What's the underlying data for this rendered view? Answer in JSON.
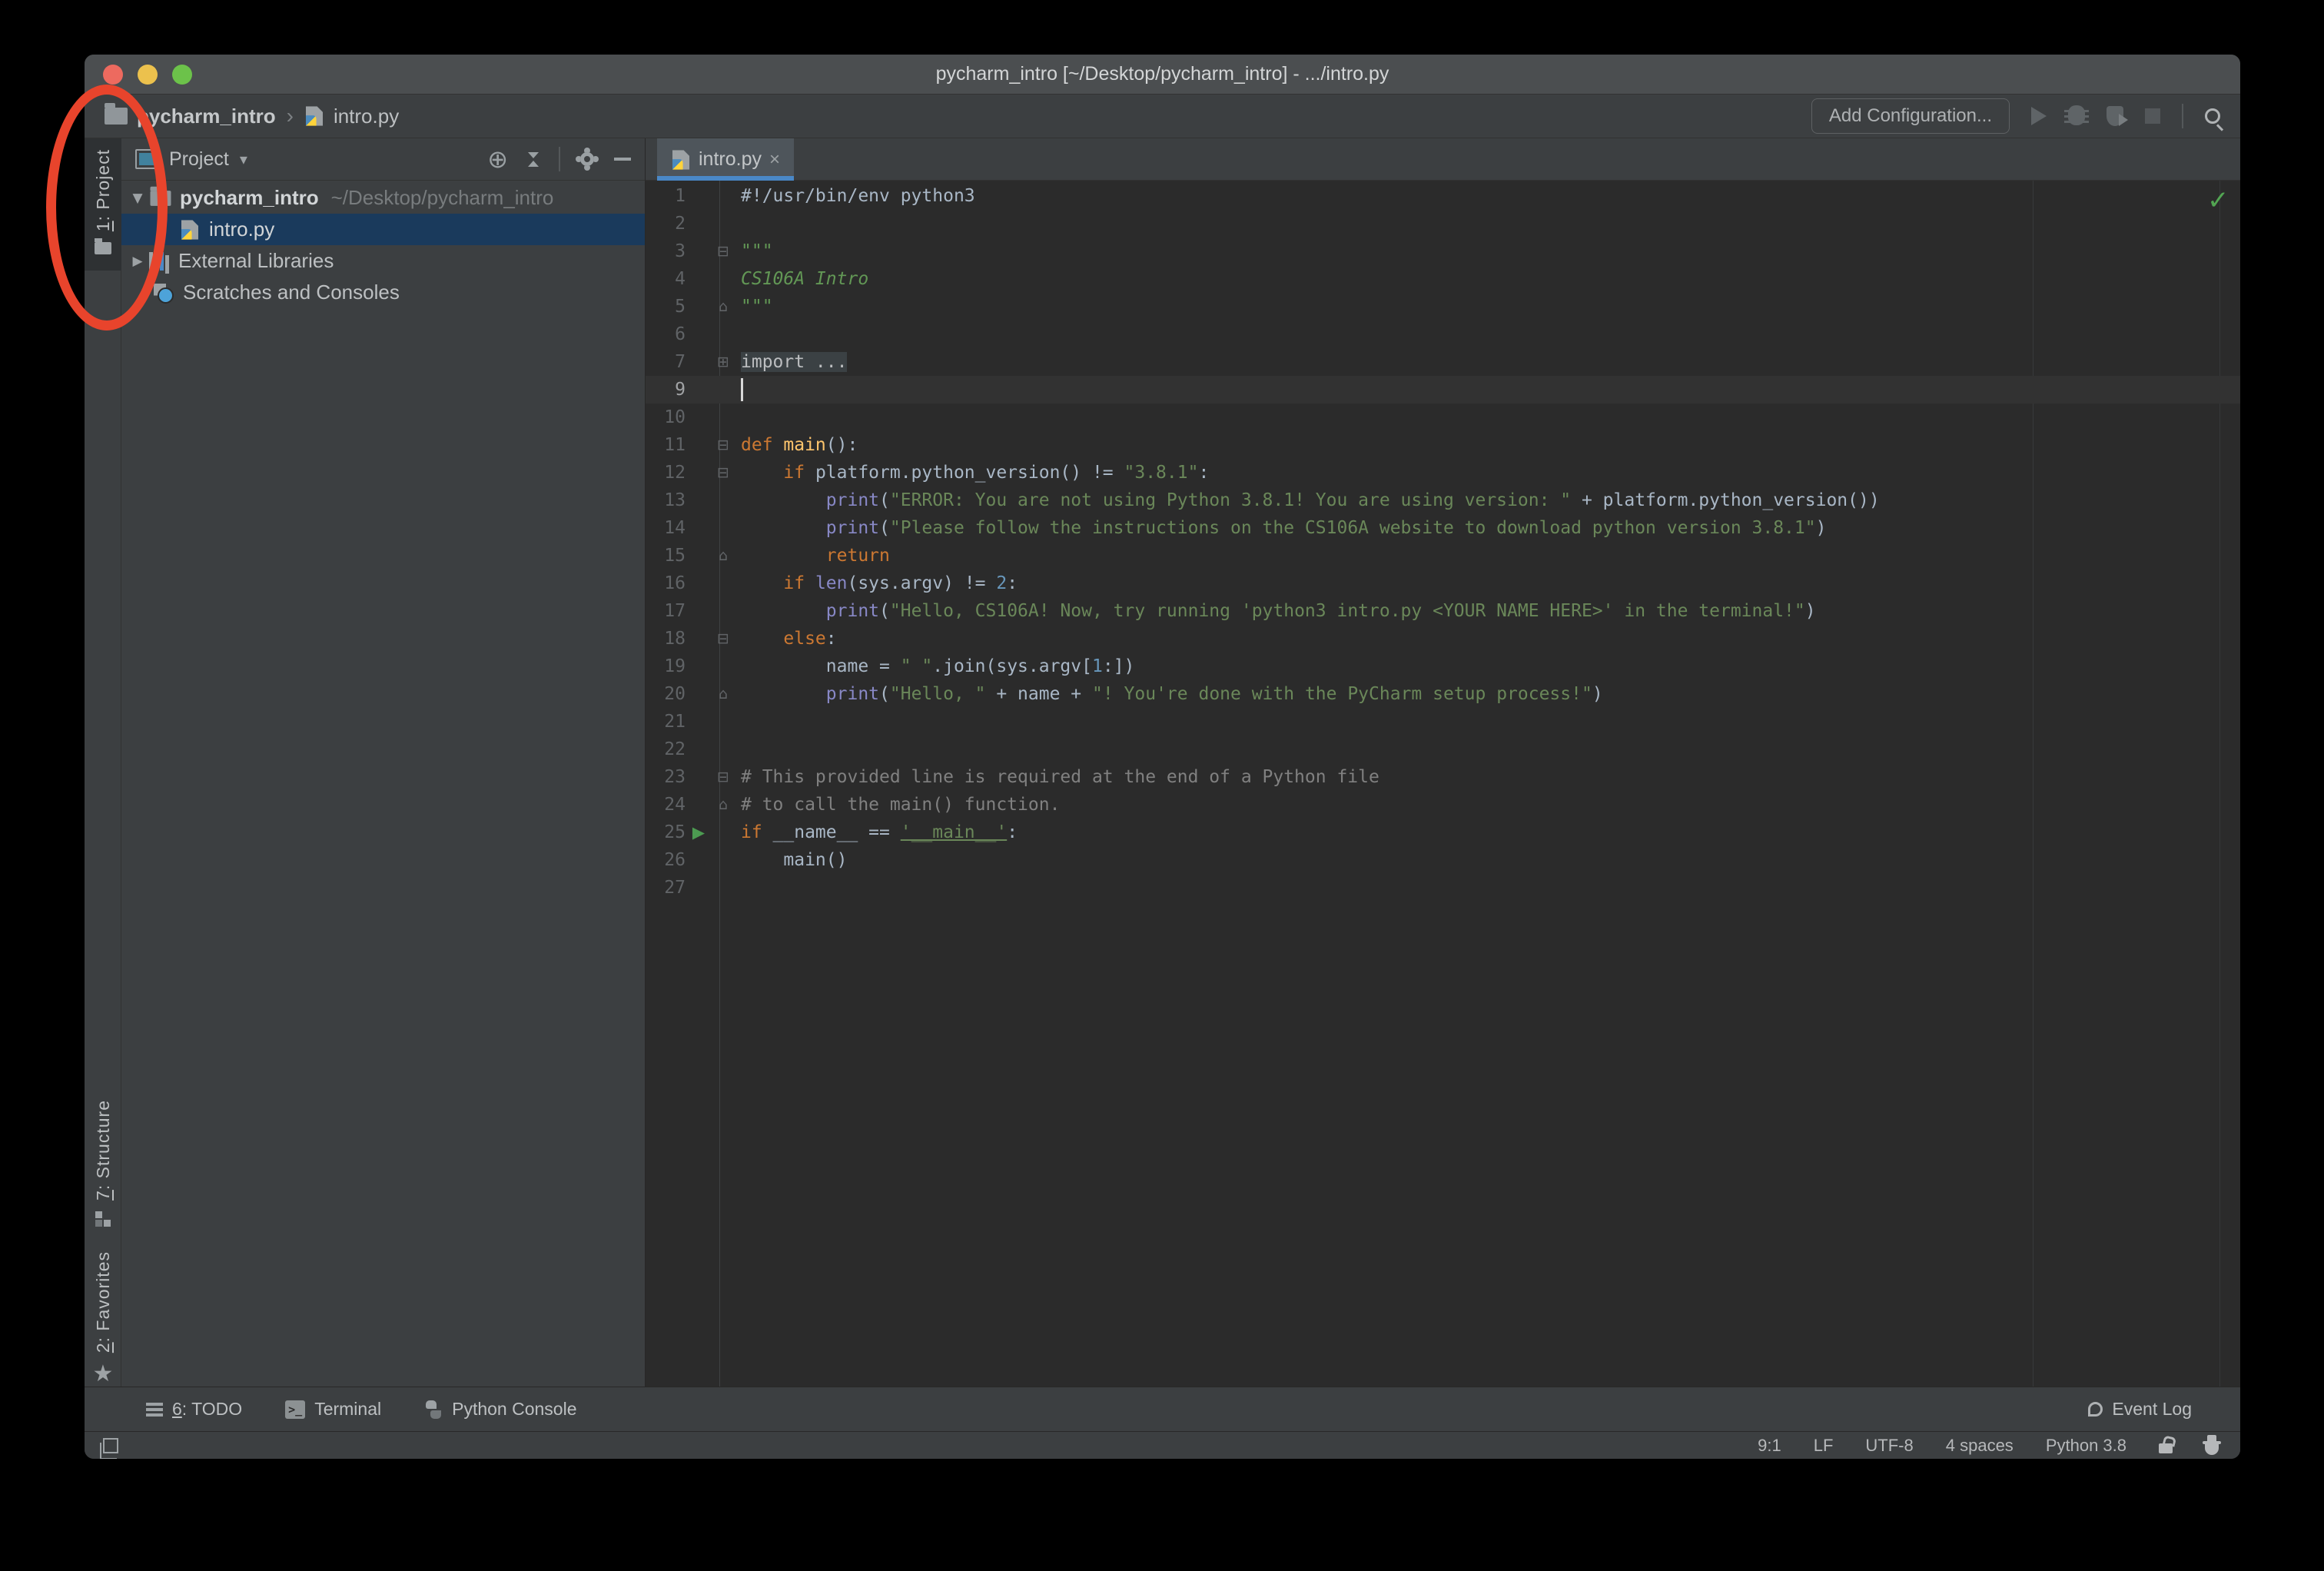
{
  "window_title": "pycharm_intro [~/Desktop/pycharm_intro] - .../intro.py",
  "navbar": {
    "breadcrumb_project": "pycharm_intro",
    "breadcrumb_separator": "›",
    "breadcrumb_file": "intro.py",
    "add_configuration": "Add Configuration..."
  },
  "left_strip": {
    "project": {
      "num": "1",
      "rest": ": Project"
    },
    "structure": {
      "num": "7",
      "rest": ": Structure"
    },
    "favorites": {
      "num": "2",
      "rest": ": Favorites"
    }
  },
  "project_panel": {
    "header": {
      "title": "Project",
      "caret": "▾"
    },
    "tree": {
      "arrow_open": "▼",
      "arrow_closed": "▶",
      "root_name": "pycharm_intro",
      "root_path": "~/Desktop/pycharm_intro",
      "file": "intro.py",
      "external": "External Libraries",
      "scratches": "Scratches and Consoles"
    }
  },
  "editor": {
    "tab": {
      "label": "intro.py",
      "close": "×"
    },
    "inspection_check": "✓",
    "lines": [
      {
        "n": 1,
        "seg": [
          [
            "txt",
            "#!/usr/bin/env python3"
          ]
        ]
      },
      {
        "n": 2,
        "seg": []
      },
      {
        "n": 3,
        "fold": "top",
        "seg": [
          [
            "doc",
            "\"\"\""
          ]
        ]
      },
      {
        "n": 4,
        "seg": [
          [
            "doc",
            "CS106A Intro"
          ]
        ]
      },
      {
        "n": 5,
        "fold": "bottom",
        "seg": [
          [
            "doc",
            "\"\"\""
          ]
        ]
      },
      {
        "n": 6,
        "seg": []
      },
      {
        "n": 7,
        "fold": "closed",
        "seg": [
          [
            "folded",
            "import ..."
          ]
        ]
      },
      {
        "n": 9,
        "caret": true,
        "seg": []
      },
      {
        "n": 10,
        "seg": []
      },
      {
        "n": 11,
        "fold": "top",
        "seg": [
          [
            "kw",
            "def "
          ],
          [
            "fn",
            "main"
          ],
          [
            "txt",
            "():"
          ]
        ]
      },
      {
        "n": 12,
        "fold": "top",
        "seg": [
          [
            "txt",
            "    "
          ],
          [
            "kw",
            "if "
          ],
          [
            "txt",
            "platform.python_version() != "
          ],
          [
            "str",
            "\"3.8.1\""
          ],
          [
            "txt",
            ":"
          ]
        ]
      },
      {
        "n": 13,
        "seg": [
          [
            "txt",
            "        "
          ],
          [
            "bi",
            "print"
          ],
          [
            "txt",
            "("
          ],
          [
            "str",
            "\"ERROR: You are not using Python 3.8.1! You are using version: \""
          ],
          [
            "txt",
            " + platform.python_version())"
          ]
        ]
      },
      {
        "n": 14,
        "seg": [
          [
            "txt",
            "        "
          ],
          [
            "bi",
            "print"
          ],
          [
            "txt",
            "("
          ],
          [
            "str",
            "\"Please follow the instructions on the CS106A website to download python version 3.8.1\""
          ],
          [
            "txt",
            ")"
          ]
        ]
      },
      {
        "n": 15,
        "fold": "bottom",
        "seg": [
          [
            "txt",
            "        "
          ],
          [
            "kw",
            "return"
          ]
        ]
      },
      {
        "n": 16,
        "seg": [
          [
            "txt",
            "    "
          ],
          [
            "kw",
            "if "
          ],
          [
            "bi",
            "len"
          ],
          [
            "txt",
            "(sys.argv) != "
          ],
          [
            "num",
            "2"
          ],
          [
            "txt",
            ":"
          ]
        ]
      },
      {
        "n": 17,
        "seg": [
          [
            "txt",
            "        "
          ],
          [
            "bi",
            "print"
          ],
          [
            "txt",
            "("
          ],
          [
            "str",
            "\"Hello, CS106A! Now, try running 'python3 intro.py <YOUR NAME HERE>' in the terminal!\""
          ],
          [
            "txt",
            ")"
          ]
        ]
      },
      {
        "n": 18,
        "fold": "top",
        "seg": [
          [
            "txt",
            "    "
          ],
          [
            "kw",
            "else"
          ],
          [
            "txt",
            ":"
          ]
        ]
      },
      {
        "n": 19,
        "seg": [
          [
            "txt",
            "        name = "
          ],
          [
            "str",
            "\" \""
          ],
          [
            "txt",
            ".join(sys.argv["
          ],
          [
            "num",
            "1"
          ],
          [
            "txt",
            ":])"
          ]
        ]
      },
      {
        "n": 20,
        "fold": "bottom",
        "seg": [
          [
            "txt",
            "        "
          ],
          [
            "bi",
            "print"
          ],
          [
            "txt",
            "("
          ],
          [
            "str",
            "\"Hello, \""
          ],
          [
            "txt",
            " + name + "
          ],
          [
            "str",
            "\"! You're done with the PyCharm setup process!\""
          ],
          [
            "txt",
            ")"
          ]
        ]
      },
      {
        "n": 21,
        "seg": []
      },
      {
        "n": 22,
        "seg": []
      },
      {
        "n": 23,
        "fold": "top",
        "seg": [
          [
            "cmt",
            "# This provided line is required at the end of a Python file"
          ]
        ]
      },
      {
        "n": 24,
        "fold": "bottom",
        "seg": [
          [
            "cmt",
            "# to call the main() function."
          ]
        ]
      },
      {
        "n": 25,
        "run": true,
        "seg": [
          [
            "kw",
            "if "
          ],
          [
            "txt",
            "__name__ == "
          ],
          [
            "strU",
            "'__main__'"
          ],
          [
            "txt",
            ":"
          ]
        ]
      },
      {
        "n": 26,
        "seg": [
          [
            "txt",
            "    main()"
          ]
        ]
      },
      {
        "n": 27,
        "seg": []
      }
    ]
  },
  "toolbar": {
    "todo": {
      "num": "6",
      "rest": ": TODO"
    },
    "terminal": "Terminal",
    "python_console": "Python Console",
    "event_log": "Event Log",
    "terminal_glyph": ">_"
  },
  "statusbar": {
    "position": "9:1",
    "line_ending": "LF",
    "encoding": "UTF-8",
    "indent": "4 spaces",
    "interpreter": "Python 3.8"
  },
  "colors": {
    "accent_blue": "#4A88C7",
    "selection_blue": "#1a3a5c",
    "annotation_red": "#E8442C",
    "run_green": "#4C9B51",
    "editor_bg": "#2b2b2b",
    "panel_bg": "#3c3f41"
  }
}
